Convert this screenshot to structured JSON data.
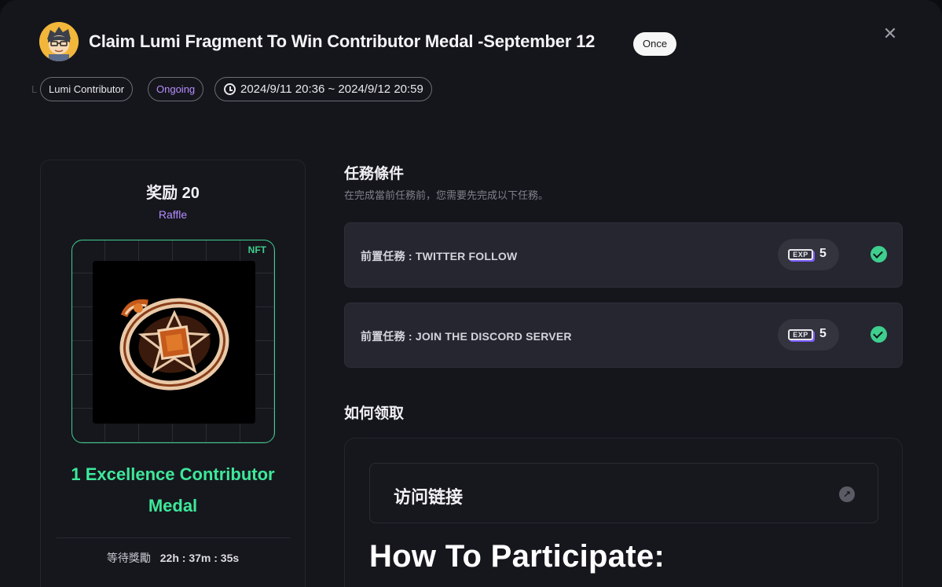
{
  "header": {
    "title": "Claim Lumi Fragment To Win Contributor Medal -September 12",
    "frequency": "Once",
    "ghost_label": "L",
    "tags": {
      "category": "Lumi Contributor",
      "status": "Ongoing",
      "time_range": "2024/9/11 20:36 ~ 2024/9/12 20:59"
    }
  },
  "reward": {
    "title": "奖励 20",
    "type": "Raffle",
    "badge": "NFT",
    "name": "1 Excellence Contributor Medal",
    "countdown_label": "等待獎勵",
    "countdown_value": "22h : 37m : 35s"
  },
  "requirements": {
    "title": "任務條件",
    "subtitle": "在完成當前任務前，您需要先完成以下任務。",
    "tasks": [
      {
        "label": "前置任務 : TWITTER FOLLOW",
        "exp_icon": "EXP",
        "exp": "5",
        "status_icon": "check-circle"
      },
      {
        "label": "前置任務 : JOIN THE DISCORD SERVER",
        "exp_icon": "EXP",
        "exp": "5",
        "status_icon": "check-circle"
      }
    ]
  },
  "how_to_claim": {
    "title": "如何领取",
    "visit_link_label": "访问链接",
    "heading": "How To Participate:"
  },
  "colors": {
    "accent_green": "#3de89a",
    "accent_purple": "#b58cff",
    "background": "#15161c",
    "task_background": "#262631"
  }
}
